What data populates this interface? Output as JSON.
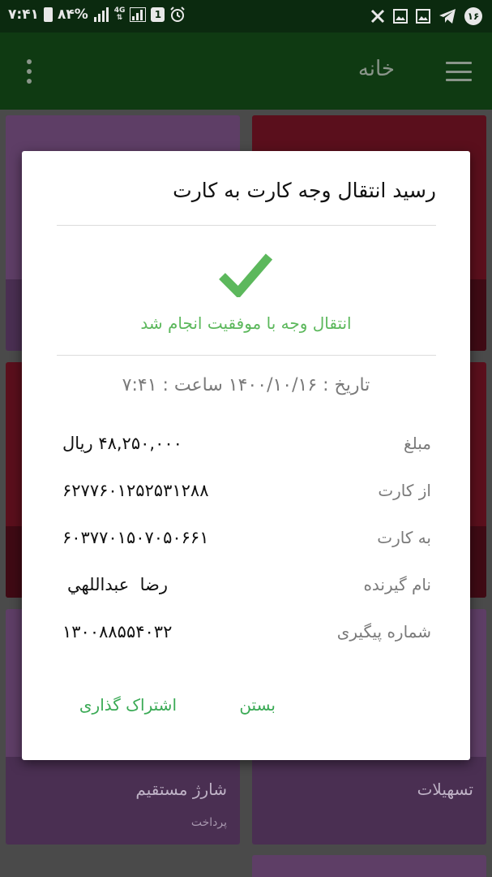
{
  "status_bar": {
    "time": "۷:۴۱",
    "battery_percent": "۸۴%",
    "network_type": "4G",
    "sim_badge": "1",
    "notif_badge": "۱۶",
    "icons": [
      "battery-icon",
      "signal-icon",
      "network-4g-icon",
      "signal-icon",
      "sim-icon",
      "alarm-icon",
      "notification-count-icon",
      "telegram-icon",
      "gallery-icon",
      "gallery-icon",
      "close-icon"
    ]
  },
  "app_bar": {
    "title": "خانه",
    "menu_icon": "hamburger-icon",
    "overflow_icon": "more-vert-icon"
  },
  "background_tiles": {
    "tile_left_bottom_label": "شارژ مستقیم",
    "tile_left_bottom_sub": "پرداخت",
    "tile_right_bottom_label": "تسهیلات"
  },
  "dialog": {
    "title": "رسید انتقال وجه کارت به کارت",
    "success_icon": "check-icon",
    "success_color": "#5cb85c",
    "success_text": "انتقال وجه با موفقیت انجام شد",
    "date_text": "تاریخ : ۱۴۰۰/۱۰/۱۶ ساعت : ۷:۴۱",
    "rows": [
      {
        "label": "مبلغ",
        "value": "۴۸,۲۵۰,۰۰۰ ریال"
      },
      {
        "label": "از کارت",
        "value": "۶۲۷۷۶۰۱۲۵۲۵۳۱۲۸۸"
      },
      {
        "label": "به کارت",
        "value": "۶۰۳۷۷۰۱۵۰۷۰۵۰۶۶۱"
      },
      {
        "label": "نام گیرنده",
        "value": "رضا  عبداللهي"
      },
      {
        "label": "شماره پیگیری",
        "value": "۱۳۰۰۸۸۵۵۴۰۳۲"
      }
    ],
    "close_label": "بستن",
    "share_label": "اشتراک گذاری",
    "accent_color": "#3aaa55"
  }
}
